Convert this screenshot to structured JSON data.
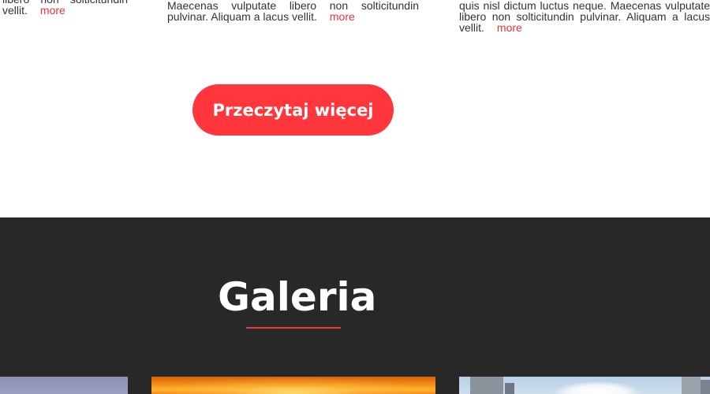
{
  "columns": [
    {
      "text": "libero non solticitundin vellit.",
      "more_label": "more"
    },
    {
      "text": "Maecenas vulputate libero non solticitundin pulvinar. Aliquam a lacus vellit.",
      "more_label": "more"
    },
    {
      "text": "quis nisl dictum luctus neque. Maecenas vulputate libero non solticitundin pulvinar. Aliquam a lacus vellit.",
      "more_label": "more"
    }
  ],
  "read_more_button": "Przeczytaj więcej",
  "gallery": {
    "title": "Galeria",
    "accent_color": "#e8343a",
    "background_color": "#282828"
  },
  "colors": {
    "button": "#ff363c",
    "link": "#e8343a"
  }
}
